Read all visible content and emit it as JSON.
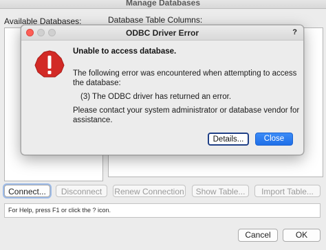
{
  "background": {
    "window_title": "Manage Databases",
    "available_databases_label": "Available Databases:",
    "table_columns_label": "Database Table Columns:",
    "buttons": {
      "connect": "Connect...",
      "disconnect": "Disconnect",
      "renew_connection": "Renew Connection",
      "show_table": "Show Table...",
      "import_table": "Import Table..."
    },
    "help_text": "For Help, press F1 or click the ? icon.",
    "cancel": "Cancel",
    "ok": "OK"
  },
  "dialog": {
    "title": "ODBC Driver Error",
    "help_button": "?",
    "icon": "error-icon",
    "heading": "Unable to access database.",
    "message_line1": "The following error was encountered when attempting to access",
    "message_line2": "the database:",
    "error_detail": "(3) The ODBC driver has returned an error.",
    "contact_line1": "Please contact your system administrator or database vendor for",
    "contact_line2": "assistance.",
    "details_button": "Details...",
    "close_button": "Close"
  },
  "colors": {
    "error_red": "#d22a26",
    "primary_blue": "#1f6fe8",
    "focus_ring": "#1f3f86"
  }
}
